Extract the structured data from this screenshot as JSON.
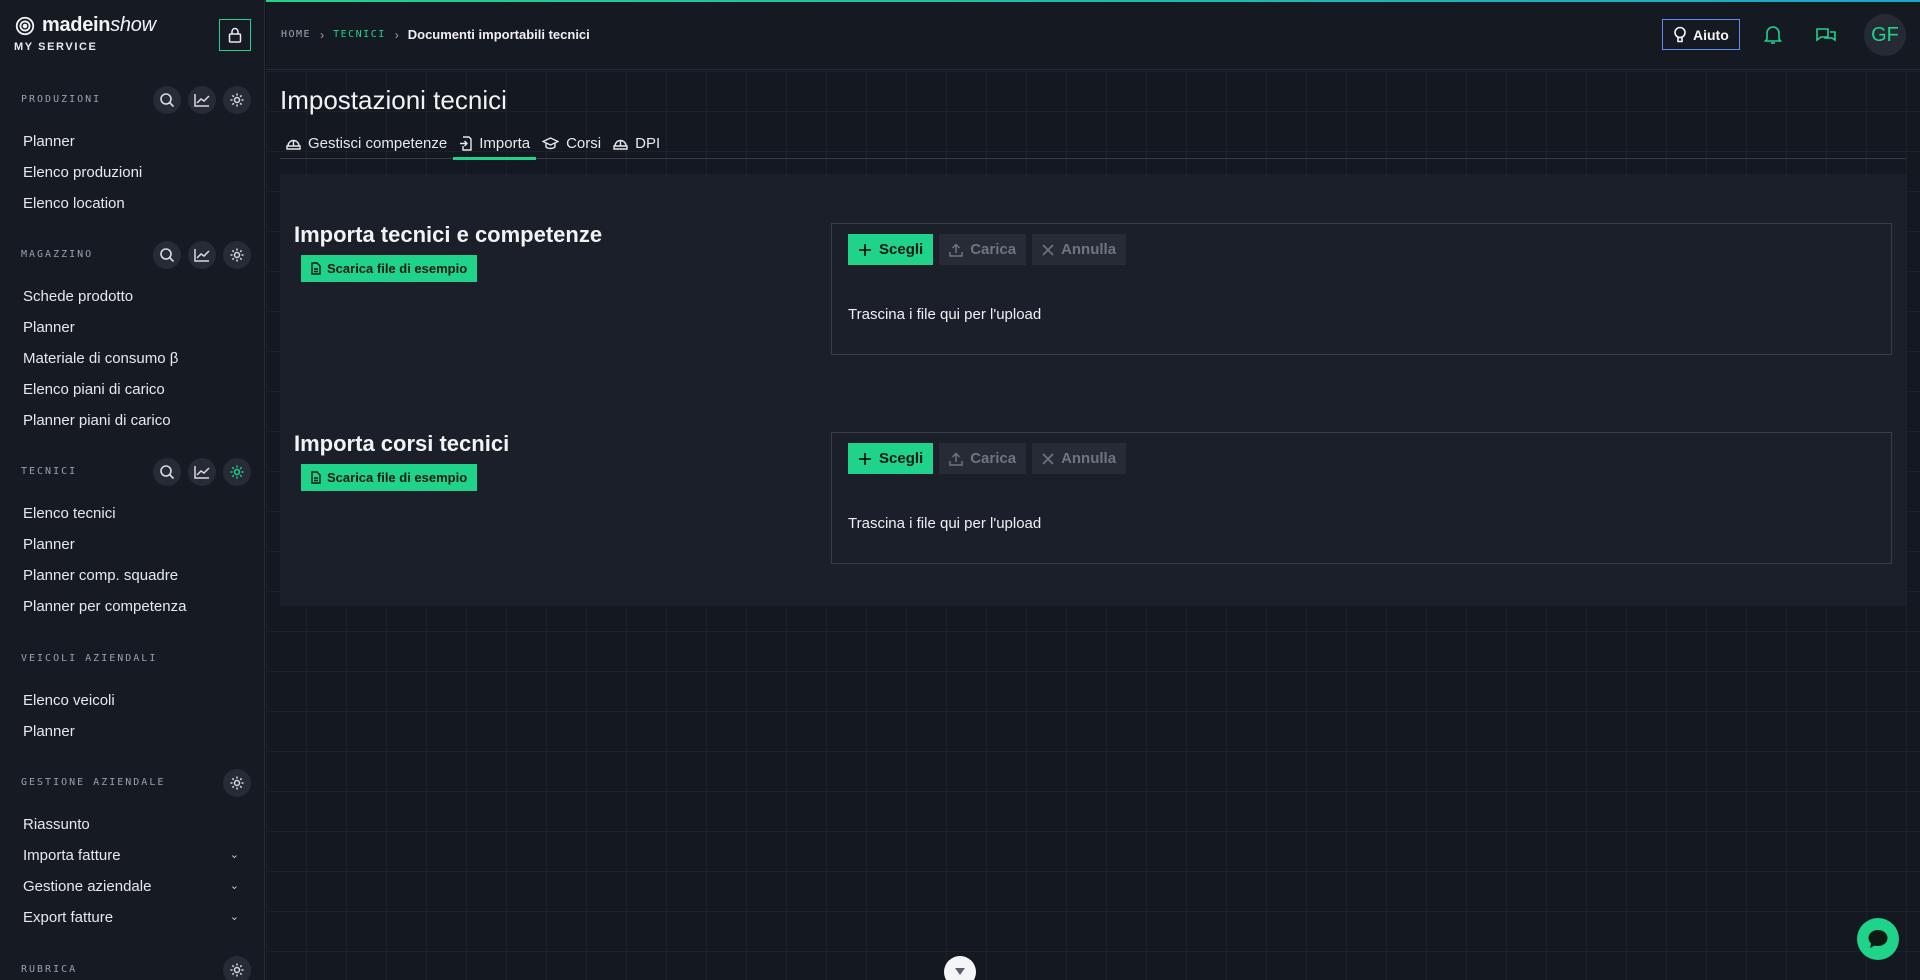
{
  "brand": {
    "name_main": "madein",
    "name_italic": "show",
    "subtitle": "MY SERVICE"
  },
  "sidebar": {
    "sections": [
      {
        "title": "PRODUZIONI",
        "items": [
          "Planner",
          "Elenco produzioni",
          "Elenco location"
        ]
      },
      {
        "title": "MAGAZZINO",
        "items": [
          "Schede prodotto",
          "Planner",
          "Materiale di consumo β",
          "Elenco piani di carico",
          "Planner piani di carico"
        ]
      },
      {
        "title": "TECNICI",
        "items": [
          "Elenco tecnici",
          "Planner",
          "Planner comp. squadre",
          "Planner per competenza"
        ]
      },
      {
        "title": "VEICOLI AZIENDALI",
        "items": [
          "Elenco veicoli",
          "Planner"
        ]
      },
      {
        "title": "GESTIONE AZIENDALE",
        "items": [
          "Riassunto",
          "Importa fatture",
          "Gestione aziendale",
          "Export fatture"
        ]
      },
      {
        "title": "RUBRICA",
        "items": []
      }
    ]
  },
  "breadcrumb": {
    "home": "HOME",
    "section": "TECNICI",
    "current": "Documenti importabili tecnici"
  },
  "header": {
    "help_label": "Aiuto",
    "avatar_initials": "GF"
  },
  "page": {
    "title": "Impostazioni tecnici",
    "tabs": [
      {
        "label": "Gestisci competenze",
        "icon": "helmet-icon"
      },
      {
        "label": "Importa",
        "icon": "import-file-icon"
      },
      {
        "label": "Corsi",
        "icon": "graduation-cap-icon"
      },
      {
        "label": "DPI",
        "icon": "helmet-icon"
      }
    ],
    "active_tab": "Importa"
  },
  "imports": [
    {
      "title": "Importa tecnici e competenze",
      "sample_label": "Scarica file di esempio",
      "choose_label": "Scegli",
      "upload_label": "Carica",
      "cancel_label": "Annulla",
      "drop_text": "Trascina i file qui per l'upload"
    },
    {
      "title": "Importa corsi tecnici",
      "sample_label": "Scarica file di esempio",
      "choose_label": "Scegli",
      "upload_label": "Carica",
      "cancel_label": "Annulla",
      "drop_text": "Trascina i file qui per l'upload"
    }
  ],
  "colors": {
    "accent": "#1fd38a",
    "help_border": "#5b8ef0",
    "background": "#12151d"
  }
}
